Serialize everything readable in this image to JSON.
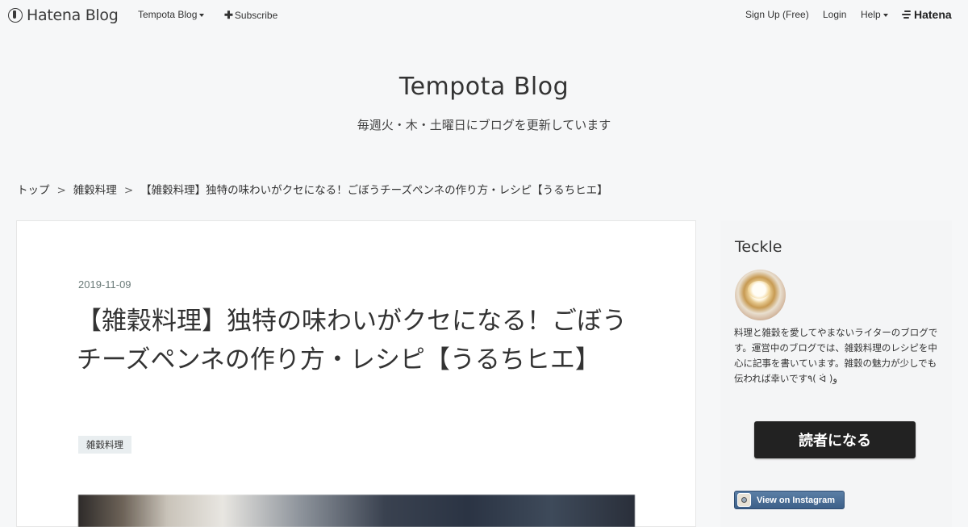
{
  "topbar": {
    "logo": "Hatena Blog",
    "blog_menu": "Tempota Blog",
    "subscribe": "Subscribe",
    "signup": "Sign Up (Free)",
    "login": "Login",
    "help": "Help",
    "hatena": "Hatena"
  },
  "header": {
    "title": "Tempota Blog",
    "description": "毎週火・木・土曜日にブログを更新しています"
  },
  "breadcrumb": {
    "items": [
      "トップ",
      "雑穀料理",
      "【雑穀料理】独特の味わいがクセになる！ごぼうチーズペンネの作り方・レシピ【うるちヒエ】"
    ],
    "separator": ">"
  },
  "article": {
    "date": "2019-11-09",
    "title": "【雑穀料理】独特の味わいがクセになる！ごぼうチーズペンネの作り方・レシピ【うるちヒエ】",
    "category": "雑穀料理"
  },
  "sidebar": {
    "profile_name": "Teckle",
    "profile_description": "料理と雑穀を愛してやまないライターのブログです。運営中のブログでは、雑穀料理のレシピを中心に記事を書いています。雑穀の魅力が少しでも伝われば幸いです٩( ᐛ )و",
    "subscribe_button": "読者になる",
    "instagram_button": "View on Instagram"
  },
  "colors": {
    "background": "#f6f7f8",
    "button_dark": "#222222",
    "instagram_blue": "#3d6089"
  },
  "icons": [
    "hatena-logo-icon",
    "caret-down-icon",
    "plus-icon",
    "hatena-lines-icon",
    "instagram-icon"
  ]
}
